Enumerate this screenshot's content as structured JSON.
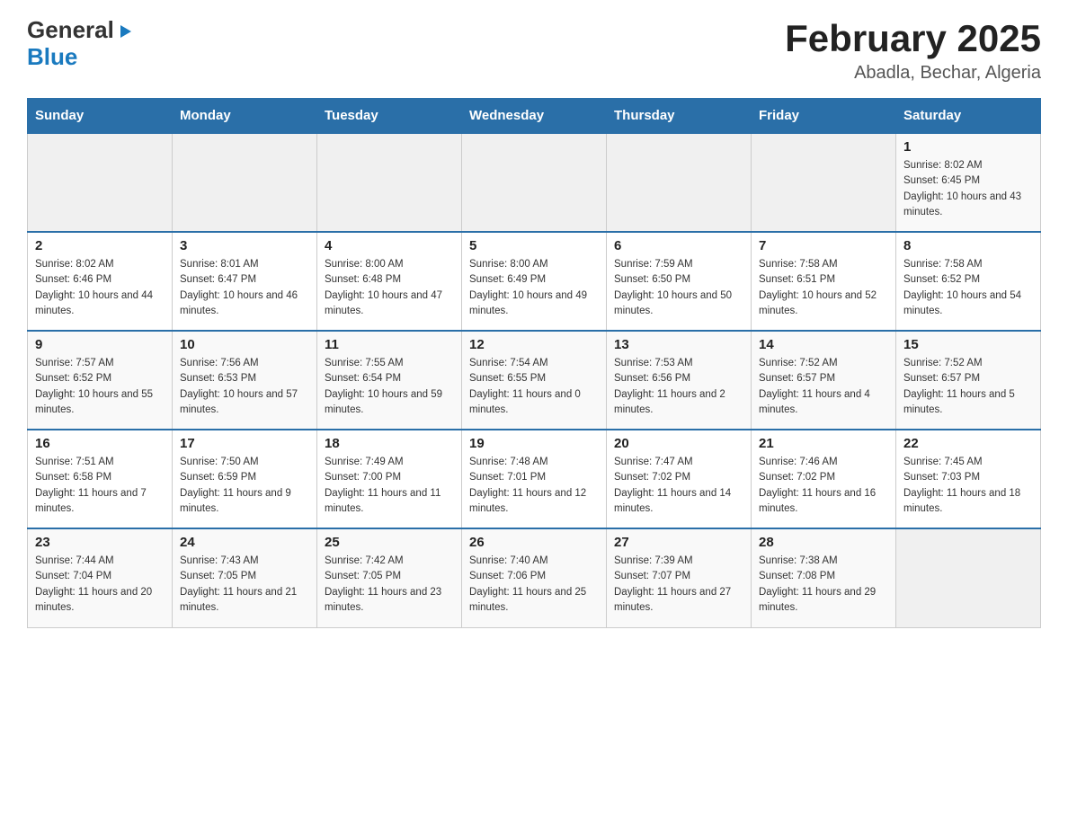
{
  "header": {
    "logo_general": "General",
    "logo_blue": "Blue",
    "main_title": "February 2025",
    "subtitle": "Abadla, Bechar, Algeria"
  },
  "days_of_week": [
    "Sunday",
    "Monday",
    "Tuesday",
    "Wednesday",
    "Thursday",
    "Friday",
    "Saturday"
  ],
  "weeks": [
    [
      {
        "day": "",
        "sunrise": "",
        "sunset": "",
        "daylight": ""
      },
      {
        "day": "",
        "sunrise": "",
        "sunset": "",
        "daylight": ""
      },
      {
        "day": "",
        "sunrise": "",
        "sunset": "",
        "daylight": ""
      },
      {
        "day": "",
        "sunrise": "",
        "sunset": "",
        "daylight": ""
      },
      {
        "day": "",
        "sunrise": "",
        "sunset": "",
        "daylight": ""
      },
      {
        "day": "",
        "sunrise": "",
        "sunset": "",
        "daylight": ""
      },
      {
        "day": "1",
        "sunrise": "Sunrise: 8:02 AM",
        "sunset": "Sunset: 6:45 PM",
        "daylight": "Daylight: 10 hours and 43 minutes."
      }
    ],
    [
      {
        "day": "2",
        "sunrise": "Sunrise: 8:02 AM",
        "sunset": "Sunset: 6:46 PM",
        "daylight": "Daylight: 10 hours and 44 minutes."
      },
      {
        "day": "3",
        "sunrise": "Sunrise: 8:01 AM",
        "sunset": "Sunset: 6:47 PM",
        "daylight": "Daylight: 10 hours and 46 minutes."
      },
      {
        "day": "4",
        "sunrise": "Sunrise: 8:00 AM",
        "sunset": "Sunset: 6:48 PM",
        "daylight": "Daylight: 10 hours and 47 minutes."
      },
      {
        "day": "5",
        "sunrise": "Sunrise: 8:00 AM",
        "sunset": "Sunset: 6:49 PM",
        "daylight": "Daylight: 10 hours and 49 minutes."
      },
      {
        "day": "6",
        "sunrise": "Sunrise: 7:59 AM",
        "sunset": "Sunset: 6:50 PM",
        "daylight": "Daylight: 10 hours and 50 minutes."
      },
      {
        "day": "7",
        "sunrise": "Sunrise: 7:58 AM",
        "sunset": "Sunset: 6:51 PM",
        "daylight": "Daylight: 10 hours and 52 minutes."
      },
      {
        "day": "8",
        "sunrise": "Sunrise: 7:58 AM",
        "sunset": "Sunset: 6:52 PM",
        "daylight": "Daylight: 10 hours and 54 minutes."
      }
    ],
    [
      {
        "day": "9",
        "sunrise": "Sunrise: 7:57 AM",
        "sunset": "Sunset: 6:52 PM",
        "daylight": "Daylight: 10 hours and 55 minutes."
      },
      {
        "day": "10",
        "sunrise": "Sunrise: 7:56 AM",
        "sunset": "Sunset: 6:53 PM",
        "daylight": "Daylight: 10 hours and 57 minutes."
      },
      {
        "day": "11",
        "sunrise": "Sunrise: 7:55 AM",
        "sunset": "Sunset: 6:54 PM",
        "daylight": "Daylight: 10 hours and 59 minutes."
      },
      {
        "day": "12",
        "sunrise": "Sunrise: 7:54 AM",
        "sunset": "Sunset: 6:55 PM",
        "daylight": "Daylight: 11 hours and 0 minutes."
      },
      {
        "day": "13",
        "sunrise": "Sunrise: 7:53 AM",
        "sunset": "Sunset: 6:56 PM",
        "daylight": "Daylight: 11 hours and 2 minutes."
      },
      {
        "day": "14",
        "sunrise": "Sunrise: 7:52 AM",
        "sunset": "Sunset: 6:57 PM",
        "daylight": "Daylight: 11 hours and 4 minutes."
      },
      {
        "day": "15",
        "sunrise": "Sunrise: 7:52 AM",
        "sunset": "Sunset: 6:57 PM",
        "daylight": "Daylight: 11 hours and 5 minutes."
      }
    ],
    [
      {
        "day": "16",
        "sunrise": "Sunrise: 7:51 AM",
        "sunset": "Sunset: 6:58 PM",
        "daylight": "Daylight: 11 hours and 7 minutes."
      },
      {
        "day": "17",
        "sunrise": "Sunrise: 7:50 AM",
        "sunset": "Sunset: 6:59 PM",
        "daylight": "Daylight: 11 hours and 9 minutes."
      },
      {
        "day": "18",
        "sunrise": "Sunrise: 7:49 AM",
        "sunset": "Sunset: 7:00 PM",
        "daylight": "Daylight: 11 hours and 11 minutes."
      },
      {
        "day": "19",
        "sunrise": "Sunrise: 7:48 AM",
        "sunset": "Sunset: 7:01 PM",
        "daylight": "Daylight: 11 hours and 12 minutes."
      },
      {
        "day": "20",
        "sunrise": "Sunrise: 7:47 AM",
        "sunset": "Sunset: 7:02 PM",
        "daylight": "Daylight: 11 hours and 14 minutes."
      },
      {
        "day": "21",
        "sunrise": "Sunrise: 7:46 AM",
        "sunset": "Sunset: 7:02 PM",
        "daylight": "Daylight: 11 hours and 16 minutes."
      },
      {
        "day": "22",
        "sunrise": "Sunrise: 7:45 AM",
        "sunset": "Sunset: 7:03 PM",
        "daylight": "Daylight: 11 hours and 18 minutes."
      }
    ],
    [
      {
        "day": "23",
        "sunrise": "Sunrise: 7:44 AM",
        "sunset": "Sunset: 7:04 PM",
        "daylight": "Daylight: 11 hours and 20 minutes."
      },
      {
        "day": "24",
        "sunrise": "Sunrise: 7:43 AM",
        "sunset": "Sunset: 7:05 PM",
        "daylight": "Daylight: 11 hours and 21 minutes."
      },
      {
        "day": "25",
        "sunrise": "Sunrise: 7:42 AM",
        "sunset": "Sunset: 7:05 PM",
        "daylight": "Daylight: 11 hours and 23 minutes."
      },
      {
        "day": "26",
        "sunrise": "Sunrise: 7:40 AM",
        "sunset": "Sunset: 7:06 PM",
        "daylight": "Daylight: 11 hours and 25 minutes."
      },
      {
        "day": "27",
        "sunrise": "Sunrise: 7:39 AM",
        "sunset": "Sunset: 7:07 PM",
        "daylight": "Daylight: 11 hours and 27 minutes."
      },
      {
        "day": "28",
        "sunrise": "Sunrise: 7:38 AM",
        "sunset": "Sunset: 7:08 PM",
        "daylight": "Daylight: 11 hours and 29 minutes."
      },
      {
        "day": "",
        "sunrise": "",
        "sunset": "",
        "daylight": ""
      }
    ]
  ]
}
